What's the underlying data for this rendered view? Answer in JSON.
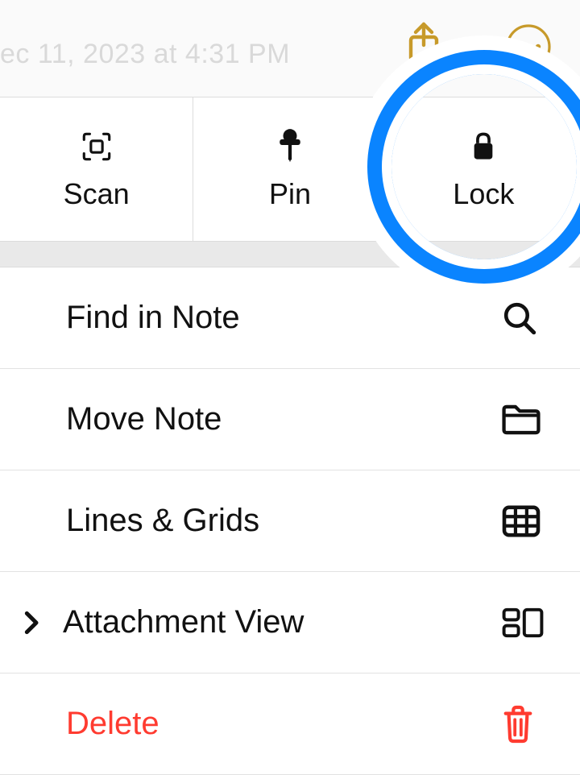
{
  "topbar": {
    "faded_text": "ec 11, 2023 at 4:31 PM"
  },
  "actions": {
    "scan": {
      "label": "Scan"
    },
    "pin": {
      "label": "Pin"
    },
    "lock": {
      "label": "Lock"
    }
  },
  "menu": {
    "find": {
      "label": "Find in Note"
    },
    "move": {
      "label": "Move Note"
    },
    "lines": {
      "label": "Lines & Grids"
    },
    "attach": {
      "label": "Attachment View"
    },
    "delete": {
      "label": "Delete"
    }
  },
  "colors": {
    "accent": "#c79a2a",
    "highlight": "#0a84ff",
    "destructive": "#ff3b30"
  }
}
